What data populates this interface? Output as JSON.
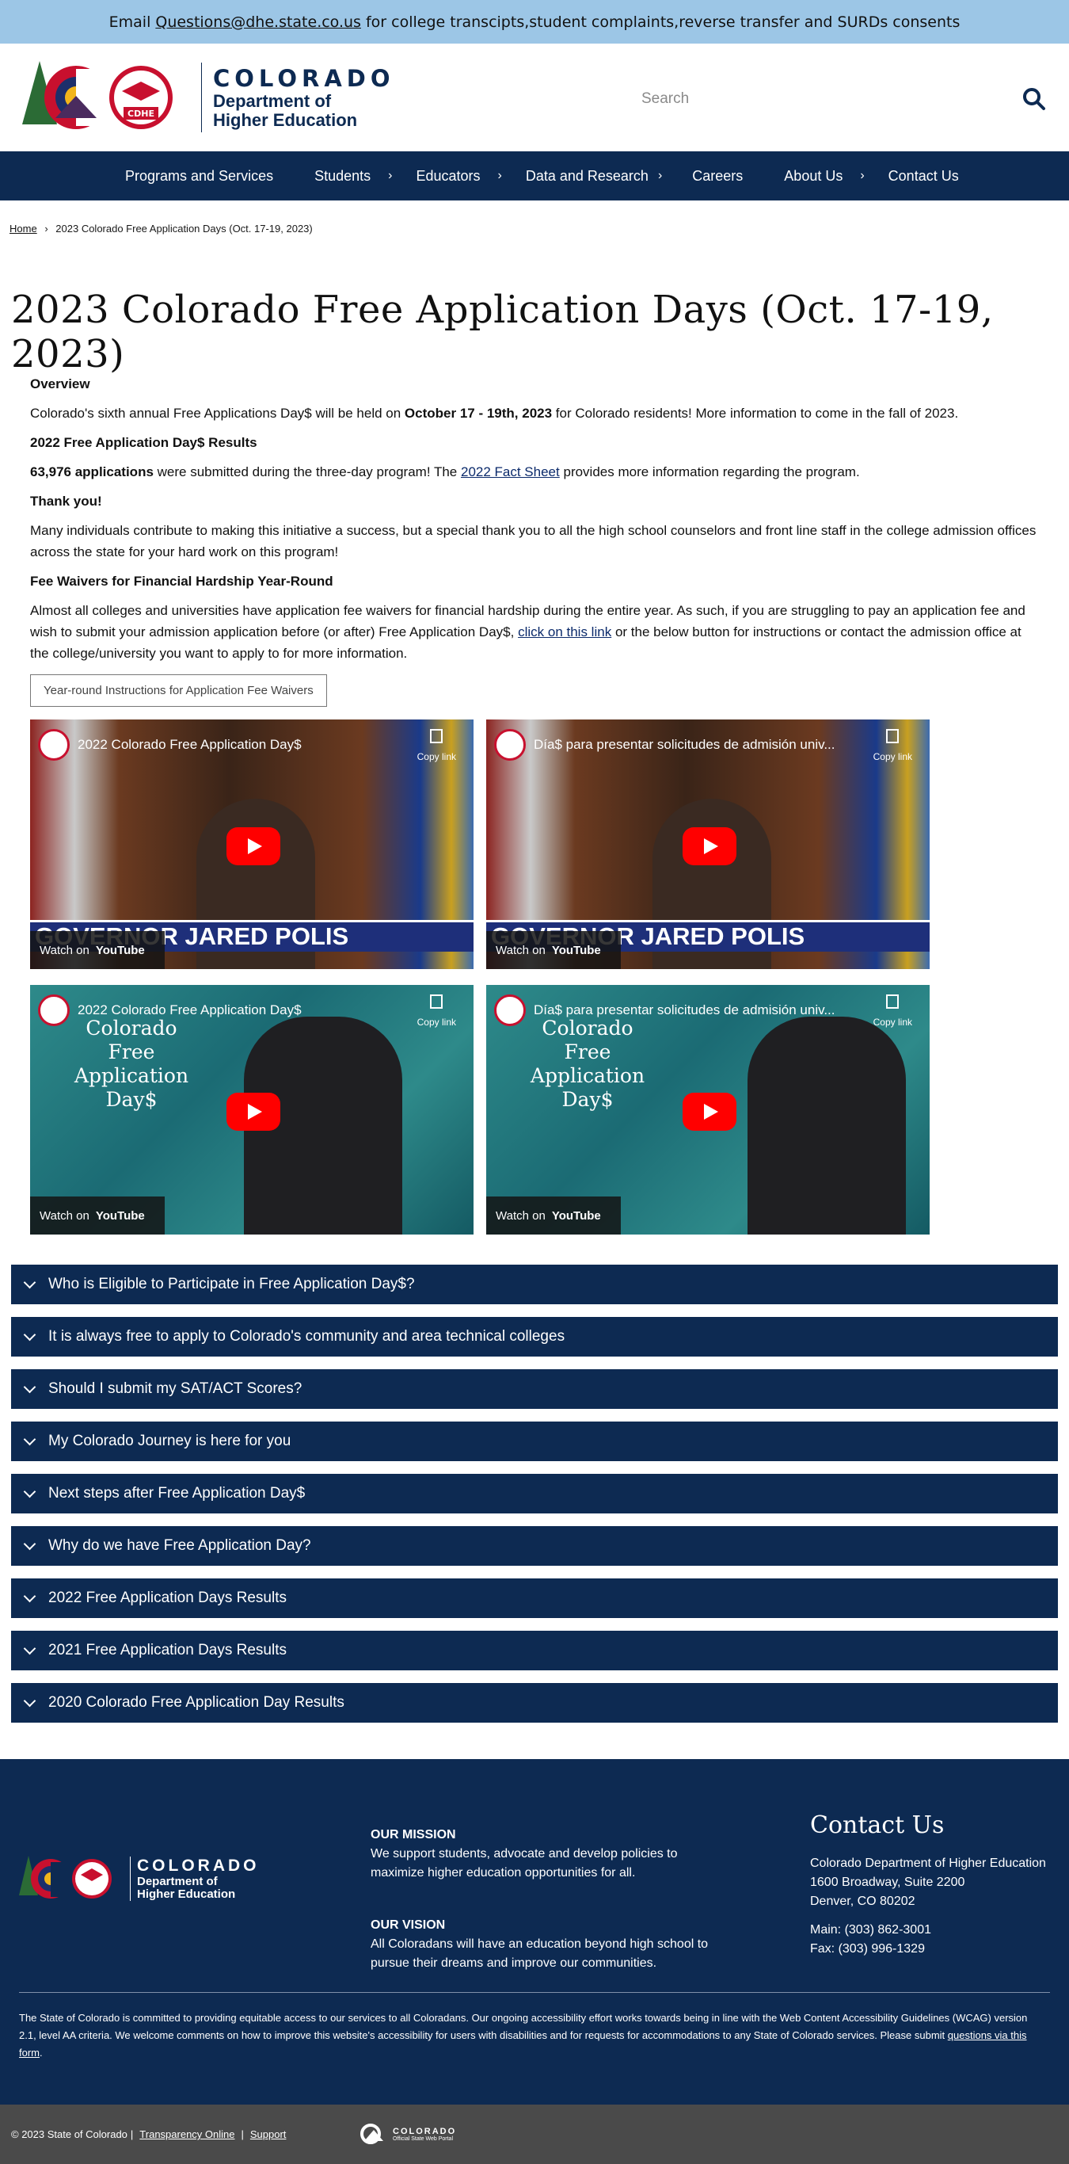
{
  "topbar": {
    "prefix": "Email",
    "email": "Questions@dhe.state.co.us",
    "suffix": "for college transcipts,student complaints,reverse transfer and SURDs consents"
  },
  "header": {
    "logo_colorado": "COLORADO",
    "logo_dept_line1": "Department of",
    "logo_dept_line2": "Higher Education",
    "logo_badge": "CDHE",
    "search_placeholder": "Search"
  },
  "nav": {
    "items": [
      {
        "label": "Programs and Services",
        "has_submenu": false
      },
      {
        "label": "Students",
        "has_submenu": true
      },
      {
        "label": "Educators",
        "has_submenu": true
      },
      {
        "label": "Data and Research",
        "has_submenu": true
      },
      {
        "label": "Careers",
        "has_submenu": false
      },
      {
        "label": "About Us",
        "has_submenu": true
      },
      {
        "label": "Contact Us",
        "has_submenu": false
      }
    ]
  },
  "breadcrumb": {
    "home": "Home",
    "separator": "›",
    "current": "2023 Colorado Free Application Days (Oct. 17-19, 2023)"
  },
  "page": {
    "title": "2023 Colorado Free Application Days (Oct. 17-19, 2023)",
    "overview_heading": "Overview",
    "overview_pre": "Colorado's sixth annual Free Applications Day$ will be held on",
    "overview_bold": "October 17 - 19th, 2023",
    "overview_post": "for Colorado residents! More information to come in the fall of 2023.",
    "results_heading": "2022 Free Application Day$ Results",
    "results_bold": "63,976 applications",
    "results_mid": "were submitted during the three-day program! The",
    "results_link": "2022 Fact Sheet",
    "results_post": "provides more information regarding the program.",
    "thanks_heading": "Thank you!",
    "thanks_text": "Many individuals contribute to making this initiative a success, but a special thank you to all the high school counselors and front line staff in the college admission offices across the state for your hard work on this program!",
    "fee_heading": "Fee Waivers for Financial Hardship Year-Round",
    "fee_pre": "Almost all colleges and universities have application fee waivers for financial hardship during the entire year. As such, if you are struggling to pay an application fee and wish to submit your admission application before (or after) Free Application Day$,",
    "fee_link": "click on this link",
    "fee_post": "or the below button for instructions or contact the admission office at the college/university you want to apply to for more information.",
    "fee_button": "Year-round Instructions for Application Fee Waivers"
  },
  "videos": [
    {
      "title": "2022 Colorado Free Application Day$",
      "copy": "Copy link",
      "watch": "Watch on",
      "yt": "YouTube",
      "banner": "GOVERNOR JARED POLIS",
      "style": "governor"
    },
    {
      "title": "Día$ para presentar solicitudes de admisión univ...",
      "copy": "Copy link",
      "watch": "Watch on",
      "yt": "YouTube",
      "banner": "GOVERNOR JARED POLIS",
      "style": "governor"
    },
    {
      "title": "2022 Colorado Free Application Day$",
      "copy": "Copy link",
      "watch": "Watch on",
      "yt": "YouTube",
      "side": "Colorado Free Application Day$",
      "style": "teal"
    },
    {
      "title": "Día$ para presentar solicitudes de admisión univ...",
      "copy": "Copy link",
      "watch": "Watch on",
      "yt": "YouTube",
      "side": "Colorado Free Application Day$",
      "style": "teal"
    }
  ],
  "accordions": [
    "Who is Eligible to Participate in Free Application Day$?",
    "It is always free to apply to Colorado's community and area technical colleges",
    "Should I submit my SAT/ACT Scores?",
    "My Colorado Journey is here for you",
    "Next steps after Free Application Day$",
    "Why do we have Free Application Day?",
    "2022 Free Application Days Results",
    "2021 Free Application Days Results",
    "2020 Colorado Free Application Day Results"
  ],
  "footer": {
    "logo_colorado": "COLORADO",
    "logo_dept_line1": "Department of",
    "logo_dept_line2": "Higher Education",
    "mission_heading": "OUR MISSION",
    "mission_text": "We support students, advocate and develop policies to maximize higher education opportunities for all.",
    "vision_heading": "OUR VISION",
    "vision_text": "All Coloradans will have an education beyond high school to pursue their dreams and improve our communities.",
    "contact_heading": "Contact Us",
    "contact_org": "Colorado Department of Higher Education",
    "contact_addr1": "1600 Broadway, Suite 2200",
    "contact_addr2": "Denver, CO 80202",
    "contact_main": "Main: (303) 862-3001",
    "contact_fax": "Fax: (303) 996-1329",
    "access_text": "The State of Colorado is committed to providing equitable access to our services to all Coloradans. Our ongoing accessibility effort works towards being in line with the Web Content Accessibility Guidelines (WCAG) version 2.1, level AA criteria. We welcome comments on how to improve this website's accessibility for users with disabilities and for requests for accommodations to any State of Colorado services. Please submit",
    "access_link": "questions via this form",
    "access_end": "."
  },
  "bottombar": {
    "copyright": "© 2023 State of Colorado",
    "sep": "|",
    "transparency": "Transparency Online",
    "support": "Support",
    "logo_colorado": "COLORADO",
    "logo_sub": "Official State Web Portal"
  },
  "colors": {
    "navy": "#0d2a52",
    "topbar": "#9cc6e6",
    "bottombar": "#4a4a4a",
    "accent_red": "#c8102e"
  }
}
